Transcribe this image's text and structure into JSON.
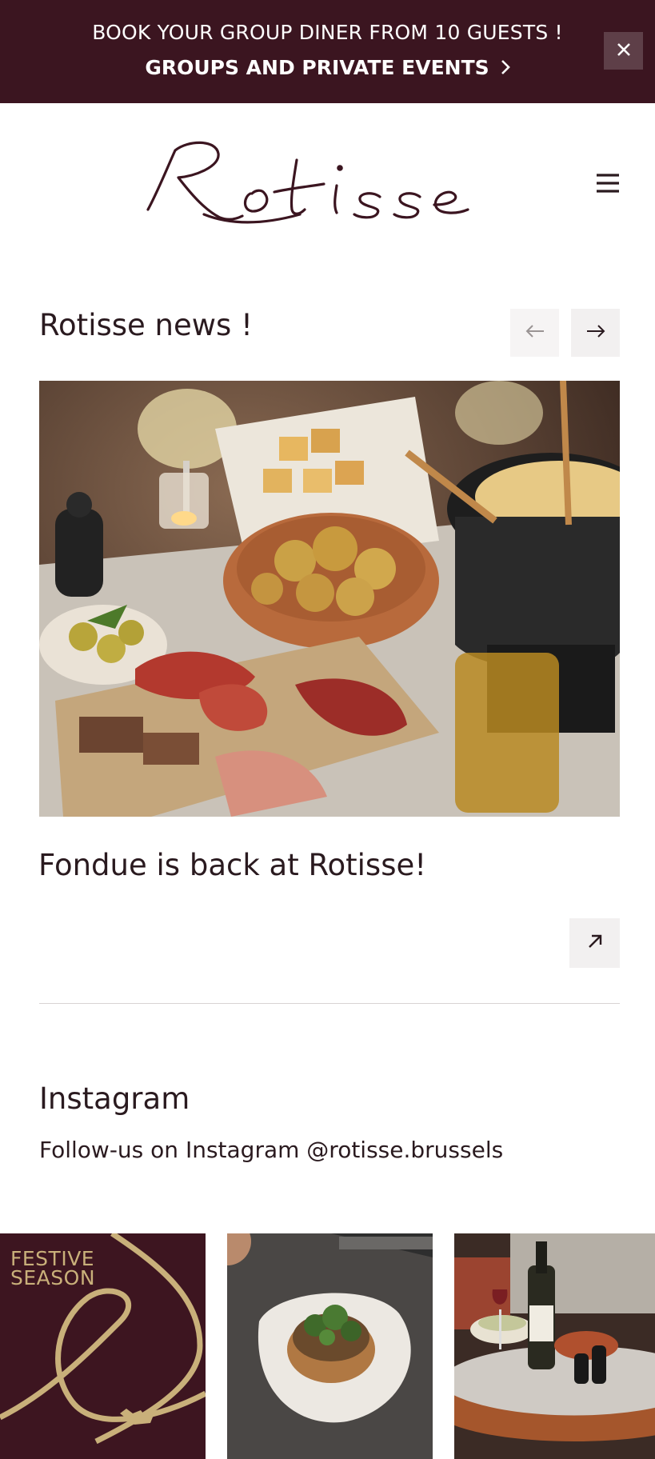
{
  "banner": {
    "line1": "BOOK YOUR GROUP DINER FROM 10 GUESTS !",
    "line2": "GROUPS AND PRIVATE EVENTS",
    "close_icon": "close-icon",
    "colors": {
      "background": "#3b1520",
      "text": "#ffffff"
    }
  },
  "header": {
    "logo_text": "Rotisse",
    "menu_icon": "hamburger-menu-icon"
  },
  "news": {
    "title": "Rotisse news !",
    "prev_icon": "arrow-left-icon",
    "next_icon": "arrow-right-icon",
    "article": {
      "headline": "Fondue is back at Rotisse!",
      "image": "cheese fondue pot with potatoes and charcuterie board",
      "open_icon": "arrow-up-right-icon"
    }
  },
  "instagram": {
    "title": "Instagram",
    "subtitle": "Follow-us on Instagram @rotisse.brussels",
    "tiles": [
      {
        "text": "FESTIVE\nSEASON",
        "image": "festive season graphic"
      },
      {
        "image": "plated toast with greens"
      },
      {
        "image": "table with wine bottle and dishes"
      }
    ]
  }
}
